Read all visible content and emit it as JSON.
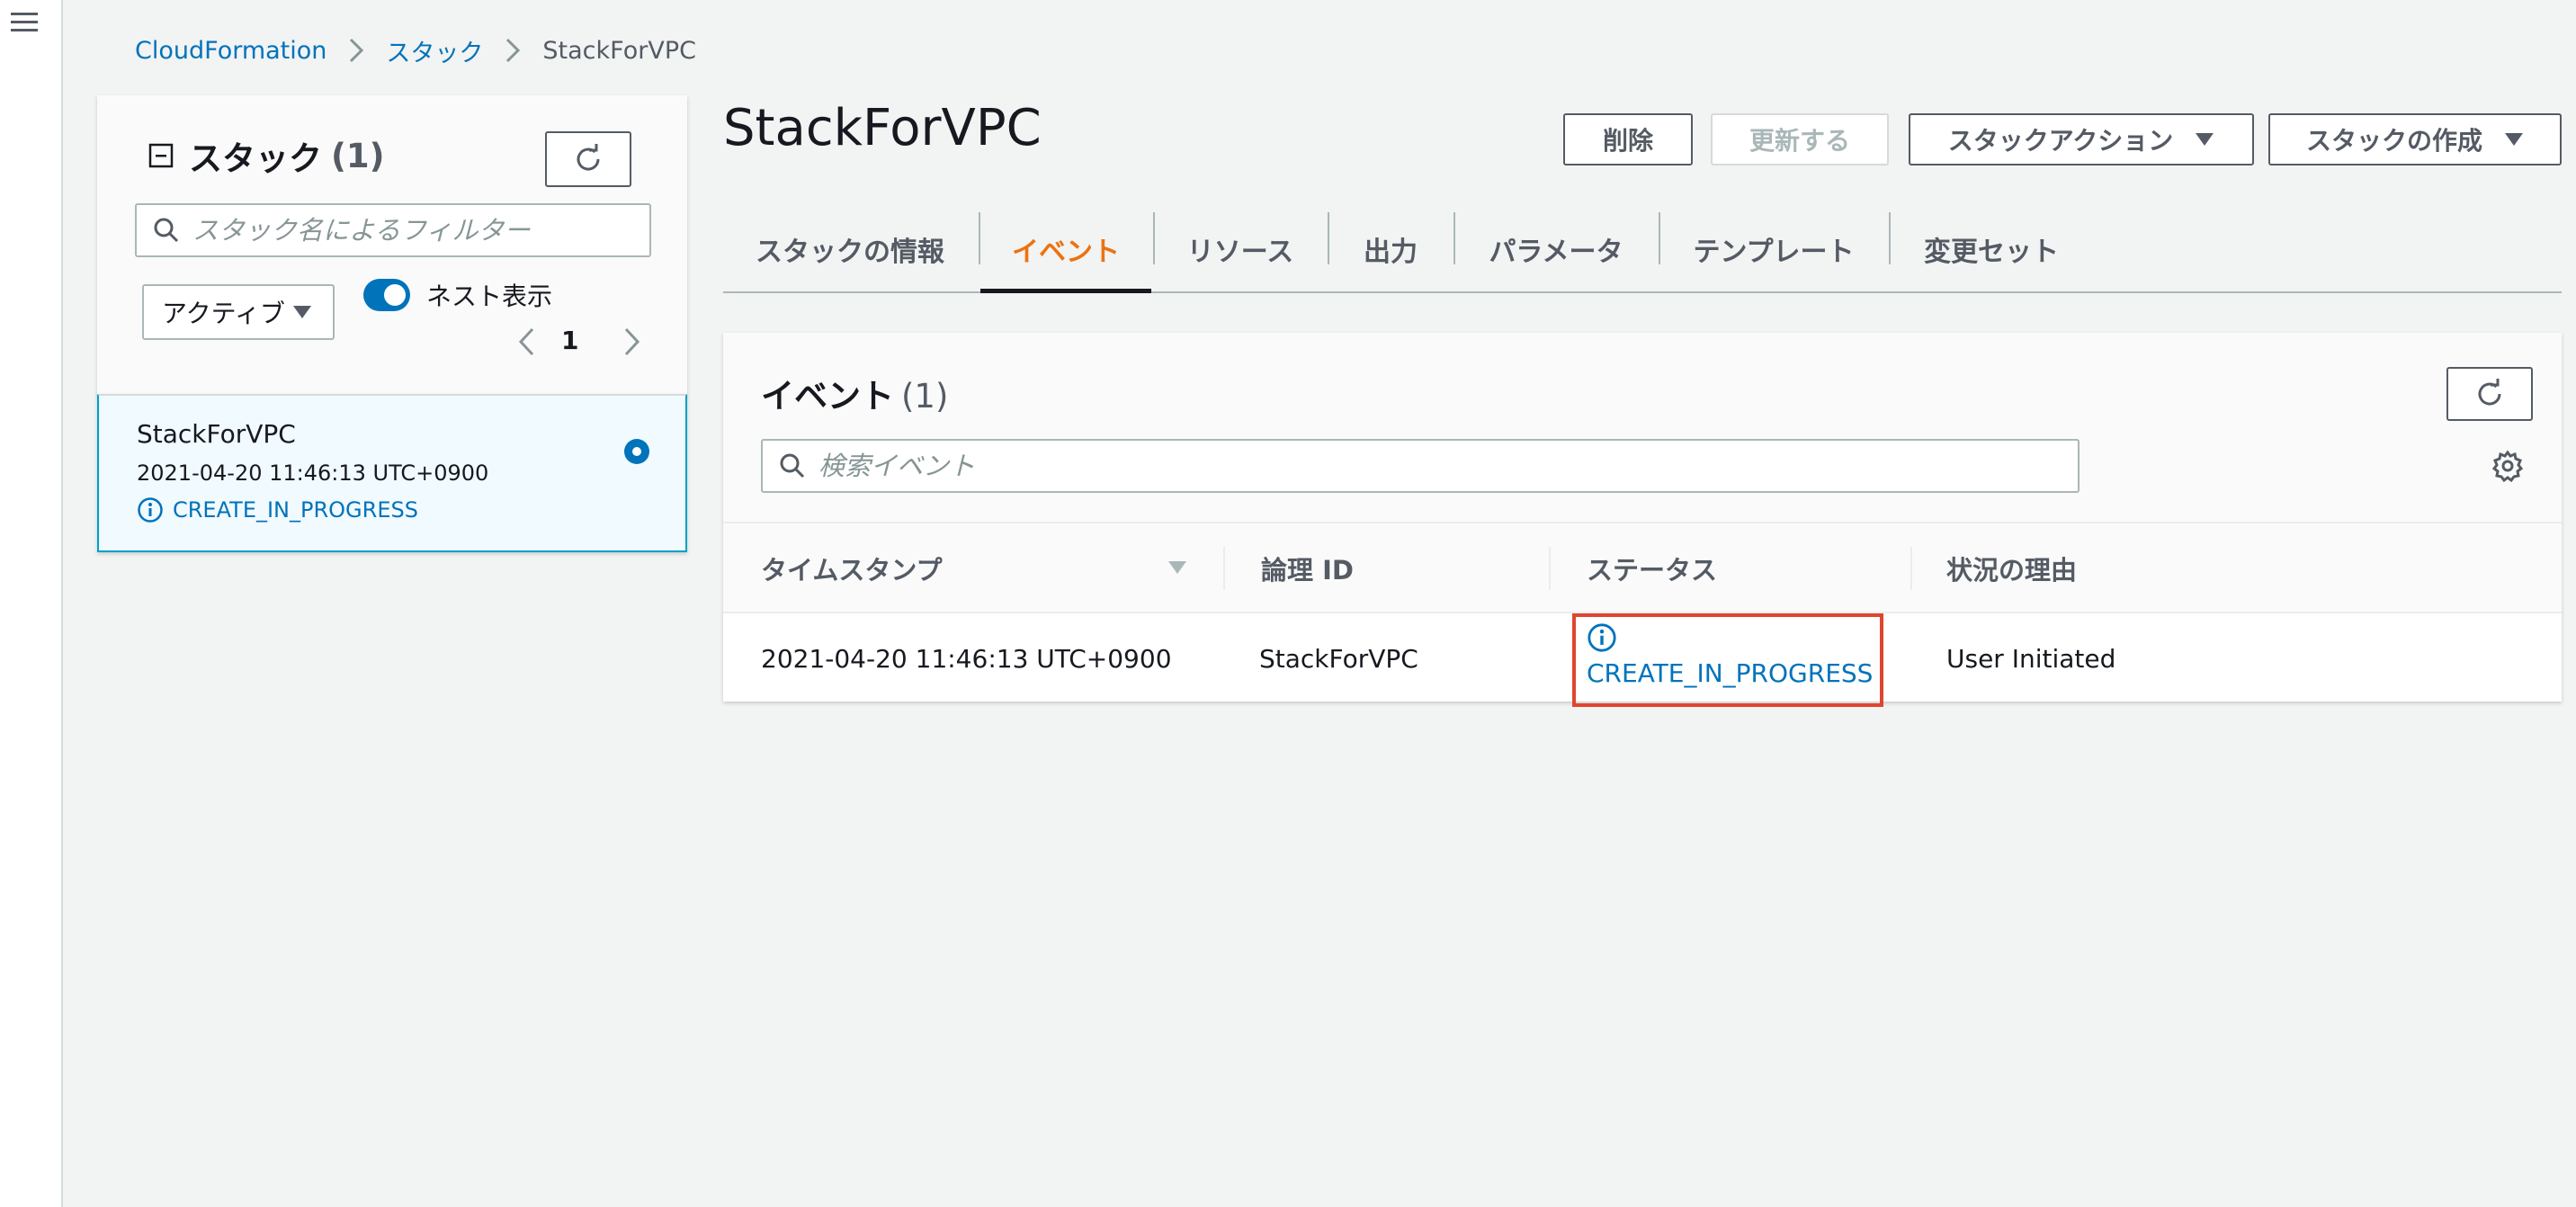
{
  "breadcrumb": {
    "items": [
      "CloudFormation",
      "スタック"
    ],
    "current": "StackForVPC"
  },
  "stack_panel": {
    "title": "スタック",
    "count": "(1)",
    "filter_placeholder": "スタック名によるフィルター",
    "status_filter": "アクティブ",
    "nested_toggle_label": "ネスト表示",
    "nested_toggle_on": true,
    "page": "1",
    "stacks": [
      {
        "name": "StackForVPC",
        "created": "2021-04-20 11:46:13 UTC+0900",
        "status": "CREATE_IN_PROGRESS"
      }
    ]
  },
  "detail": {
    "title": "StackForVPC",
    "buttons": {
      "delete": "削除",
      "update": "更新する",
      "stack_actions": "スタックアクション",
      "create_stack": "スタックの作成"
    },
    "tabs": [
      "スタックの情報",
      "イベント",
      "リソース",
      "出力",
      "パラメータ",
      "テンプレート",
      "変更セット"
    ],
    "active_tab": "イベント"
  },
  "events": {
    "title": "イベント",
    "count": "(1)",
    "search_placeholder": "検索イベント",
    "columns": [
      "タイムスタンプ",
      "論理 ID",
      "ステータス",
      "状況の理由"
    ],
    "rows": [
      {
        "timestamp": "2021-04-20 11:46:13 UTC+0900",
        "logical_id": "StackForVPC",
        "status": "CREATE_IN_PROGRESS",
        "reason": "User Initiated"
      }
    ]
  },
  "colors": {
    "link": "#0073bb",
    "active_tab": "#ec7211",
    "highlight": "#e0452d"
  },
  "icons": [
    "menu-icon",
    "chevron-right-icon",
    "collapse-icon",
    "refresh-icon",
    "search-icon",
    "caret-down-icon",
    "chevron-left-icon",
    "info-icon",
    "gear-icon",
    "sort-caret-icon"
  ]
}
